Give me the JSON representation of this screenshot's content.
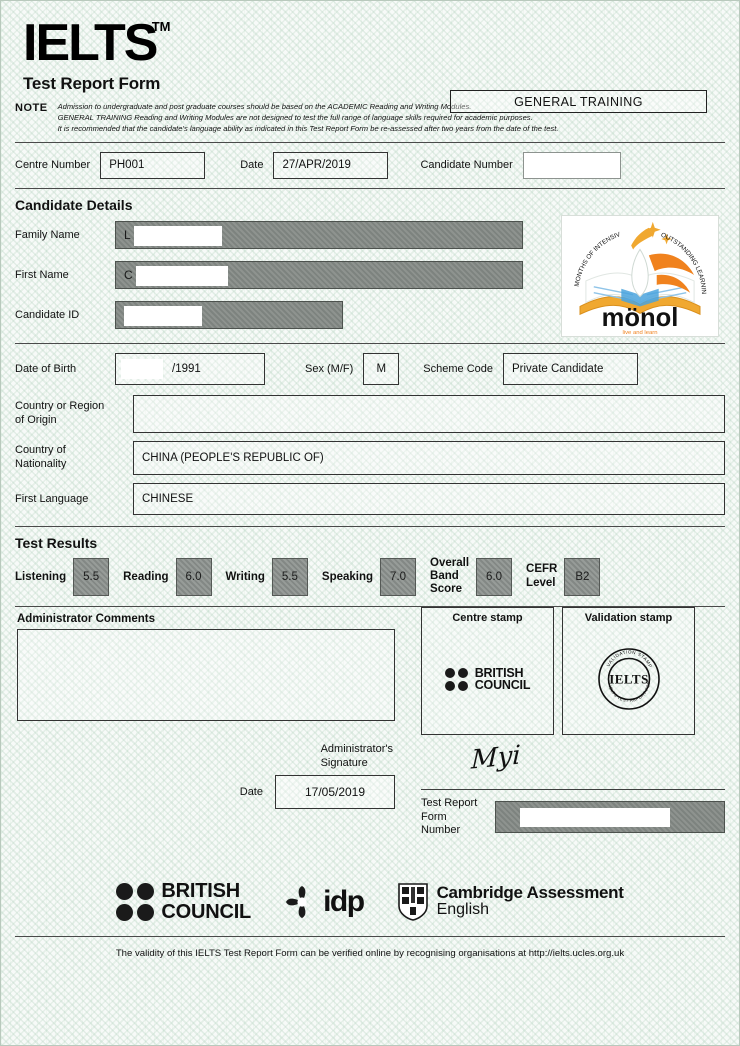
{
  "document": {
    "brand": "IELTS",
    "trademark": "TM",
    "title": "Test Report Form",
    "module": "GENERAL TRAINING"
  },
  "note": {
    "label": "NOTE",
    "lines": [
      "Admission to undergraduate and post graduate courses should be based on the ACADEMIC Reading and Writing Modules.",
      "GENERAL TRAINING Reading and Writing Modules are not designed to test the full range of language skills required for academic purposes.",
      "It is recommended that the candidate's language ability as indicated in this Test Report Form be re-assessed after two years from the date of the test."
    ]
  },
  "top_row": {
    "centre_number_label": "Centre Number",
    "centre_number": "PH001",
    "date_label": "Date",
    "date": "27/APR/2019",
    "candidate_number_label": "Candidate Number",
    "candidate_number": ""
  },
  "candidate_details": {
    "heading": "Candidate Details",
    "family_name_label": "Family Name",
    "family_name": "L",
    "first_name_label": "First Name",
    "first_name": "C",
    "candidate_id_label": "Candidate ID",
    "candidate_id": "",
    "dob_label": "Date of Birth",
    "dob": "/1991",
    "sex_label": "Sex (M/F)",
    "sex": "M",
    "scheme_code_label": "Scheme Code",
    "scheme_code": "Private Candidate",
    "origin_label": "Country or Region of Origin",
    "origin_label_line1": "Country or Region",
    "origin_label_line2": "of Origin",
    "origin": "",
    "nationality_label_line1": "Country of",
    "nationality_label_line2": "Nationality",
    "nationality": "CHINA (PEOPLE'S REPUBLIC OF)",
    "first_language_label": "First Language",
    "first_language": "CHINESE"
  },
  "test_results": {
    "heading": "Test Results",
    "listening_label": "Listening",
    "listening": "5.5",
    "reading_label": "Reading",
    "reading": "6.0",
    "writing_label": "Writing",
    "writing": "5.5",
    "speaking_label": "Speaking",
    "speaking": "7.0",
    "overall_label_line1": "Overall",
    "overall_label_line2": "Band",
    "overall_label_line3": "Score",
    "overall": "6.0",
    "cefr_label_line1": "CEFR",
    "cefr_label_line2": "Level",
    "cefr": "B2"
  },
  "administration": {
    "comments_label": "Administrator Comments",
    "comments": "",
    "signature_label_line1": "Administrator's",
    "signature_label_line2": "Signature",
    "signature_mark": "Myi",
    "date_label": "Date",
    "date": "17/05/2019",
    "trf_number_label_line1": "Test Report Form",
    "trf_number_label_line2": "Number",
    "trf_number": ""
  },
  "stamps": {
    "centre_stamp_label": "Centre stamp",
    "centre_stamp_org_line1": "BRITISH",
    "centre_stamp_org_line2": "COUNCIL",
    "validation_stamp_label": "Validation stamp",
    "validation_seal_center": "IELTS",
    "validation_seal_arc_top": "VALIDATION STAMP",
    "validation_seal_arc_bottom": "IELTS TEST REPORT FORM"
  },
  "footer": {
    "partner_british_council_line1": "BRITISH",
    "partner_british_council_line2": "COUNCIL",
    "partner_idp": "idp",
    "partner_cambridge_line1": "Cambridge Assessment",
    "partner_cambridge_line2": "English",
    "validity_note": "The validity of this IELTS Test Report Form can be verified online by recognising organisations at http://ielts.ucles.org.uk"
  },
  "colors": {
    "paper": "#f2f7f3",
    "watermark": "#78af8c",
    "redaction_gray": "#848a86",
    "ink": "#111111"
  }
}
